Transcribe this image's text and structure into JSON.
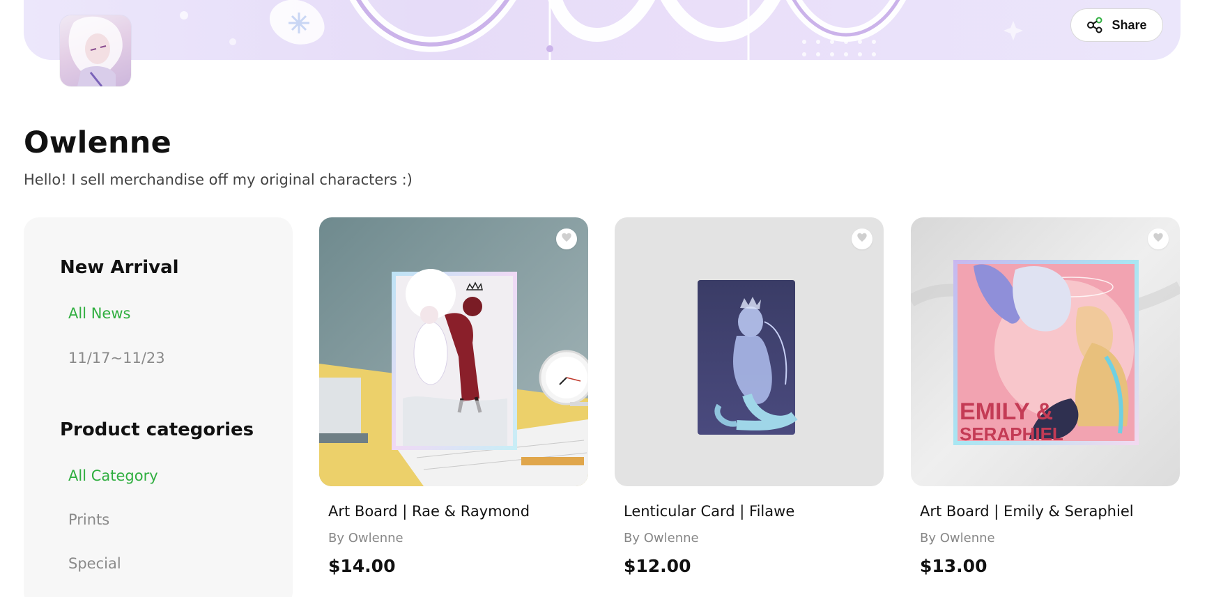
{
  "header": {
    "share_label": "Share"
  },
  "store": {
    "name": "Owlenne",
    "description": "Hello! I sell merchandise off my original characters :)"
  },
  "sidebar": {
    "sections": [
      {
        "heading": "New Arrival",
        "items": [
          {
            "label": "All News",
            "active": true
          },
          {
            "label": "11/17~11/23",
            "active": false
          }
        ]
      },
      {
        "heading": "Product categories",
        "items": [
          {
            "label": "All Category",
            "active": true
          },
          {
            "label": "Prints",
            "active": false
          },
          {
            "label": "Special",
            "active": false
          }
        ]
      }
    ]
  },
  "products": [
    {
      "title": "Art Board | Rae & Raymond",
      "by": "By Owlenne",
      "price": "$14.00"
    },
    {
      "title": "Lenticular Card | Filawe",
      "by": "By Owlenne",
      "price": "$12.00"
    },
    {
      "title": "Art Board | Emily & Seraphiel",
      "by": "By Owlenne",
      "price": "$13.00",
      "art_text": [
        "EMILY &",
        "SERAPHIEL"
      ]
    }
  ],
  "icons": {
    "share": "share-icon",
    "favorite": "heart-icon"
  },
  "colors": {
    "accent_green": "#2fae3f",
    "muted_text": "#8a8a8a",
    "banner_lavender": "#e6dcf8"
  }
}
